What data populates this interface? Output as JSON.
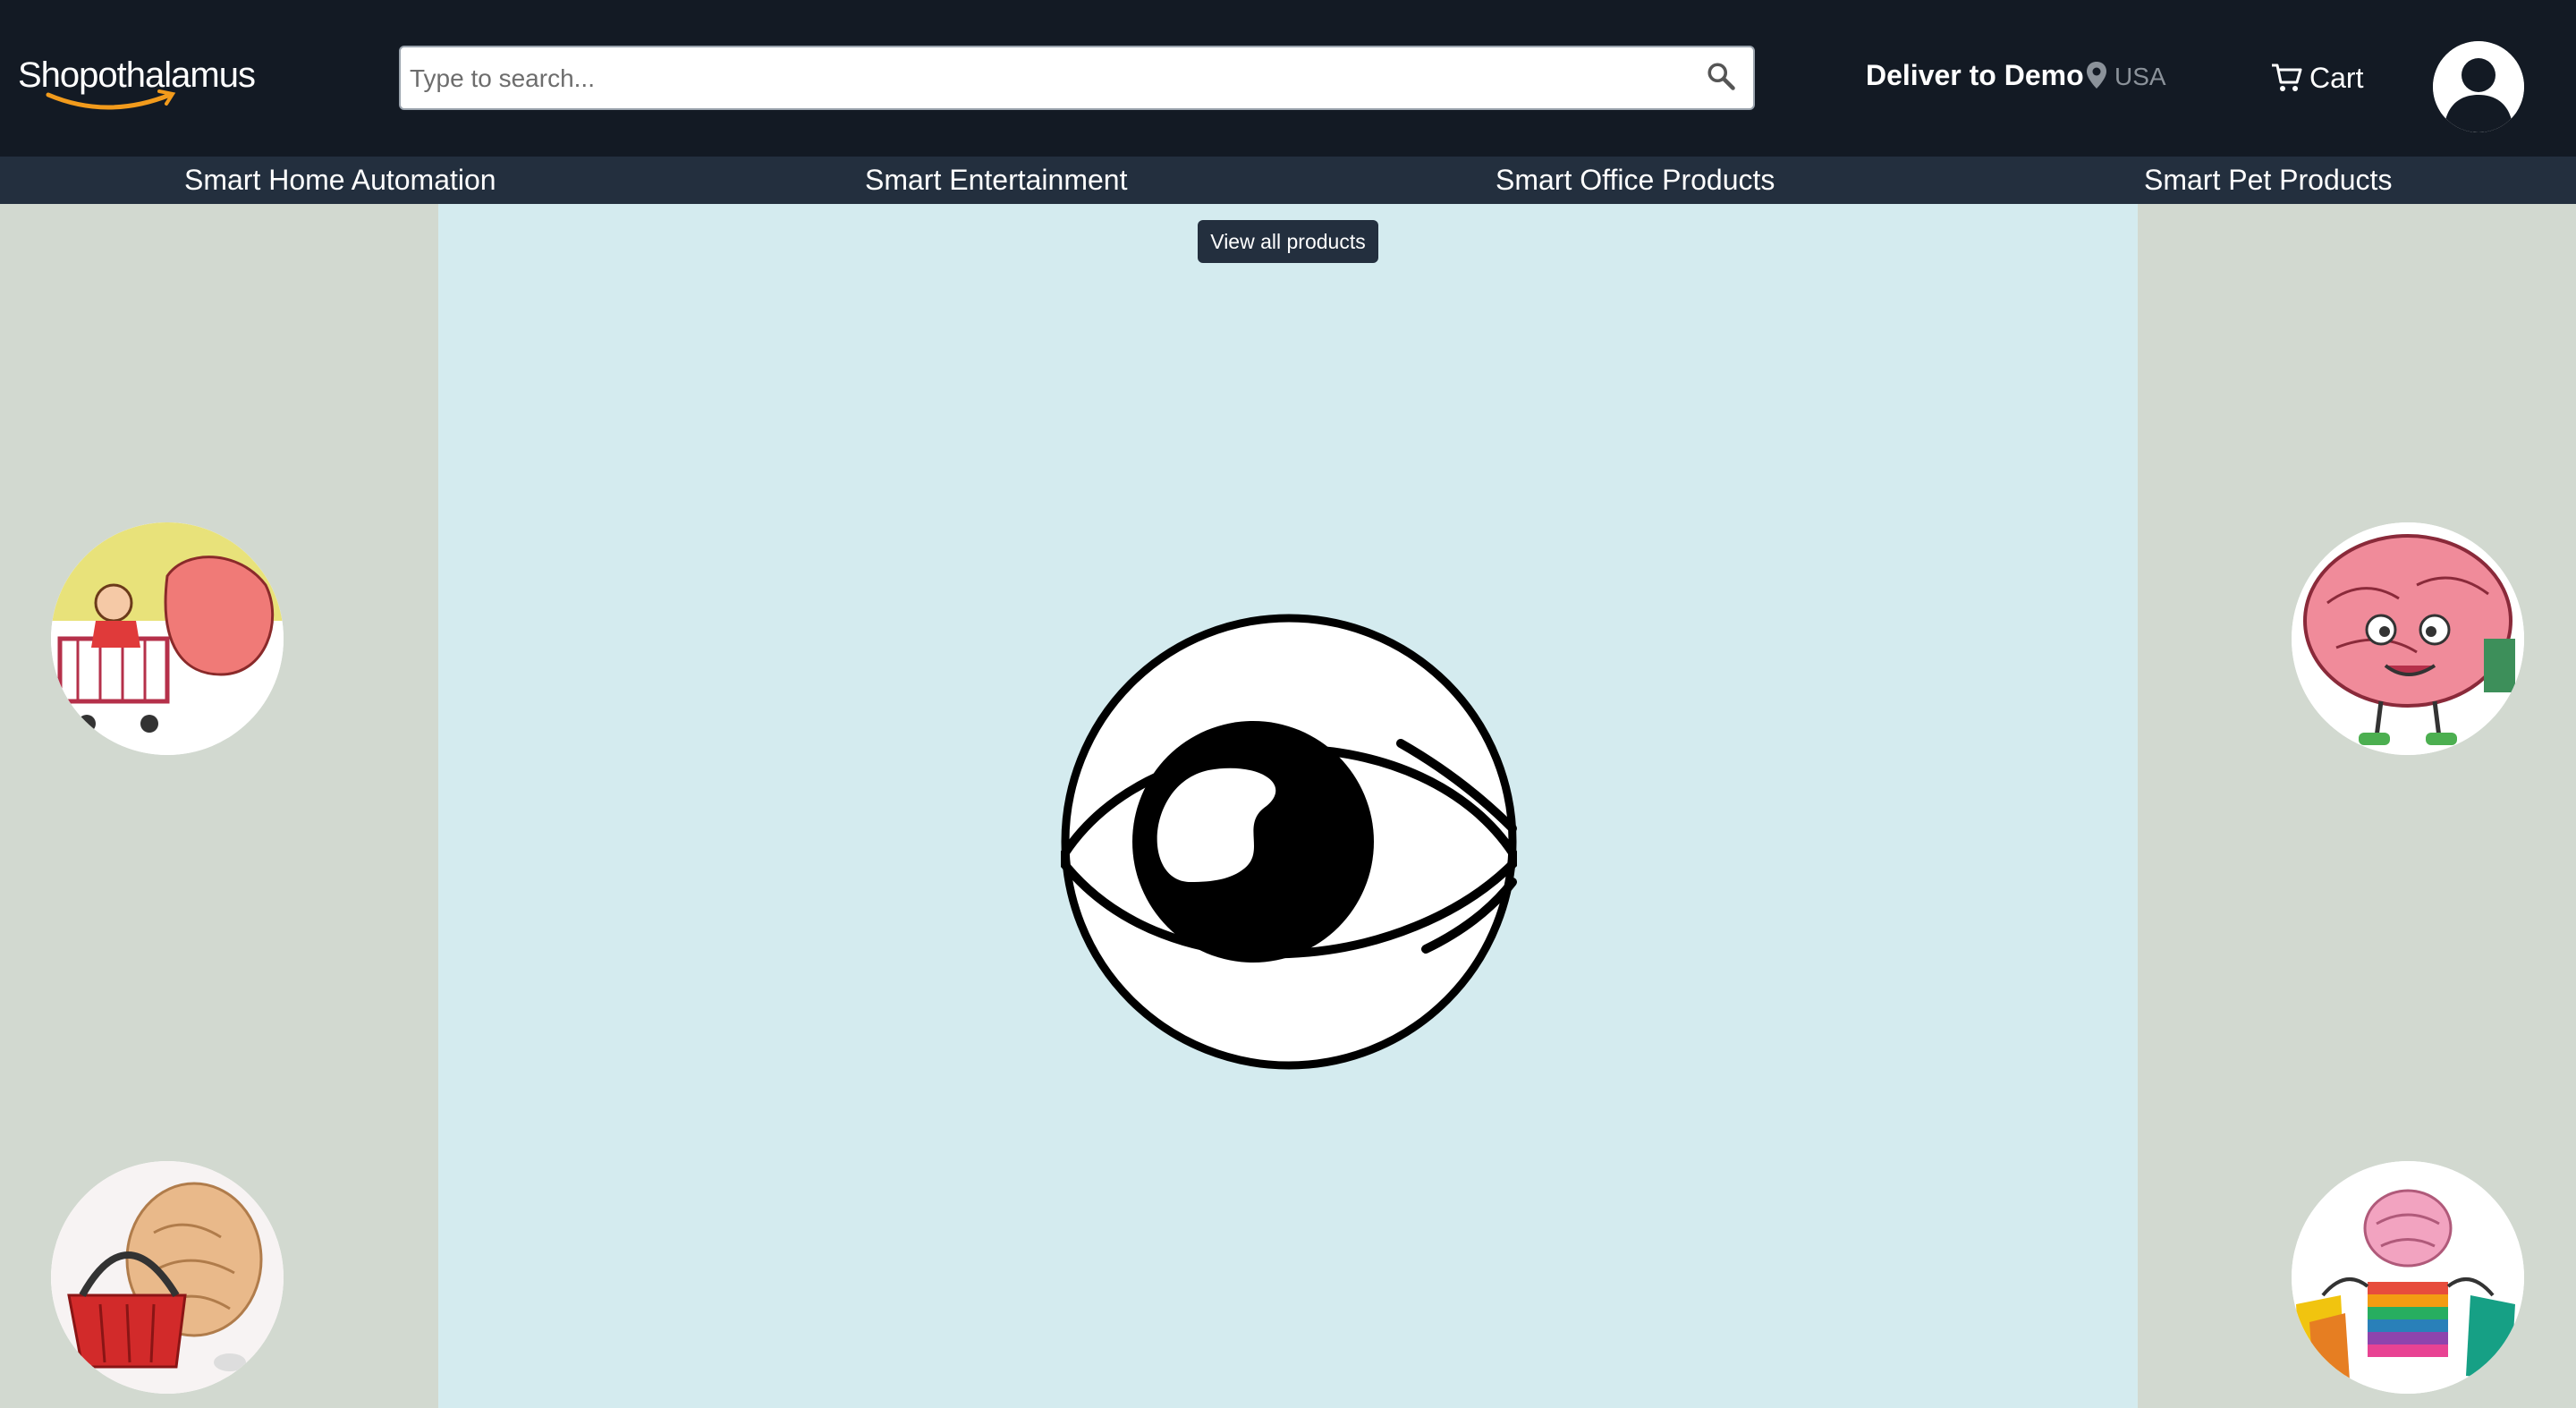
{
  "header": {
    "logo_text": "Shopothalamus",
    "search": {
      "placeholder": "Type to search...",
      "value": ""
    },
    "deliver_label": "Deliver to Demo",
    "country": "USA",
    "cart_label": "Cart"
  },
  "nav": {
    "items": [
      "Smart Home Automation",
      "Smart Entertainment",
      "Smart Office Products",
      "Smart Pet Products"
    ]
  },
  "main": {
    "view_all_label": "View all products"
  },
  "colors": {
    "topbar": "#131a24",
    "navbar": "#232f3e",
    "main_bg": "#d4ebef",
    "side_bg": "#d2d9d0",
    "logo_smile": "#f29b1c"
  },
  "icons": [
    "search-icon",
    "location-pin-icon",
    "cart-icon",
    "user-avatar-icon",
    "eye-logo-icon"
  ]
}
